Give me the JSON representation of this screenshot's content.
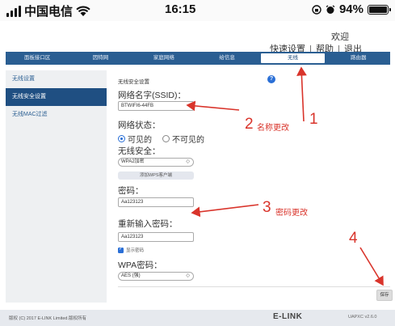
{
  "statusbar": {
    "carrier": "中国电信",
    "time": "16:15",
    "battery": "94%"
  },
  "header": {
    "welcome": "欢迎",
    "quick_setup": "快速设置",
    "help": "帮助",
    "logout": "退出",
    "separator": "|"
  },
  "nav": {
    "items": [
      {
        "label": "面板接口区"
      },
      {
        "label": "因特网"
      },
      {
        "label": "家庭网络"
      },
      {
        "label": "给信息"
      },
      {
        "label": "无线"
      },
      {
        "label": "路由器"
      }
    ],
    "active_index": 4
  },
  "sidebar": {
    "items": [
      {
        "label": "无线设置"
      },
      {
        "label": "无线安全设置"
      },
      {
        "label": "无线MAC过滤"
      }
    ],
    "active_index": 1
  },
  "form": {
    "section_title": "无线安全设置",
    "ssid_label": "网络名字(SSID)：",
    "ssid_value": "BTWIFI6-44FB",
    "status_label": "网络状态：",
    "visible_label": "可见的",
    "invisible_label": "不可见的",
    "security_label": "无线安全：",
    "security_value": "WPA2加密",
    "wps_button": "添加WPS客户端",
    "password_label": "密码：",
    "password_value": "Aa123123",
    "repeat_label": "重新输入密码：",
    "repeat_value": "Aa123123",
    "show_password": "显示密码",
    "wpa_label": "WPA密码：",
    "wpa_value": "AES (强)",
    "help_icon": "?",
    "save_button": "保存"
  },
  "footer": {
    "copyright": "版权 (C) 2017 E-LINK Limited.版权所有",
    "brand": "E-LINK",
    "version": "UAPXC v2.6.0"
  },
  "annotations": {
    "n1": "1",
    "n2": "2",
    "t2": "名称更改",
    "n3": "3",
    "t3": "密码更改",
    "n4": "4"
  },
  "colors": {
    "nav_bg": "#2a5e92",
    "sidebar_active": "#1f4f82",
    "annotation": "#d9342b",
    "accent": "#2a6fd6"
  }
}
